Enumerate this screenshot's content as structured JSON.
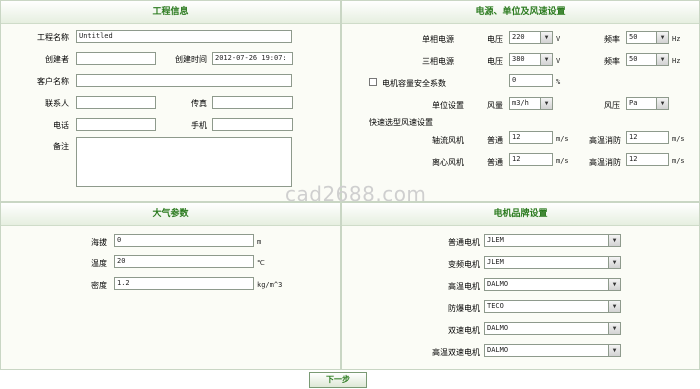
{
  "project": {
    "title": "工程信息",
    "name_label": "工程名称",
    "name_value": "Untitled",
    "creator_label": "创建者",
    "creator_value": "",
    "created_label": "创建时间",
    "created_value": "2012-07-26 19:07:",
    "client_label": "客户名称",
    "client_value": "",
    "contact_label": "联系人",
    "contact_value": "",
    "fax_label": "传真",
    "fax_value": "",
    "phone_label": "电话",
    "phone_value": "",
    "mobile_label": "手机",
    "mobile_value": "",
    "note_label": "备注",
    "note_value": ""
  },
  "power": {
    "title": "电源、单位及风速设置",
    "single_label": "单相电源",
    "voltage_label": "电压",
    "single_voltage": "220",
    "volt_unit": "V",
    "freq_label": "频率",
    "single_freq": "50",
    "hz_unit": "Hz",
    "three_label": "三相电源",
    "three_voltage": "380",
    "three_freq": "50",
    "safety_label": "电机容量安全系数",
    "safety_value": "0",
    "percent_unit": "%",
    "unit_label": "单位设置",
    "flow_label": "风量",
    "flow_value": "m3/h",
    "pressure_label": "风压",
    "pressure_value": "Pa",
    "quick_label": "快速选型风速设置",
    "axial_label": "轴流风机",
    "normal_label": "普通",
    "axial_normal": "12",
    "ms_unit": "m/s",
    "highfire_label": "高温消防",
    "axial_high": "12",
    "centri_label": "离心风机",
    "centri_normal": "12",
    "centri_high": "12"
  },
  "atmo": {
    "title": "大气参数",
    "altitude_label": "海拔",
    "altitude_value": "0",
    "altitude_unit": "m",
    "temp_label": "温度",
    "temp_value": "20",
    "temp_unit": "℃",
    "density_label": "密度",
    "density_value": "1.2",
    "density_unit": "kg/m^3"
  },
  "motor": {
    "title": "电机品牌设置",
    "rows": [
      {
        "label": "普通电机",
        "value": "JLEM"
      },
      {
        "label": "变频电机",
        "value": "JLEM"
      },
      {
        "label": "高温电机",
        "value": "DALMO"
      },
      {
        "label": "防爆电机",
        "value": "TECO"
      },
      {
        "label": "双速电机",
        "value": "DALMO"
      },
      {
        "label": "高温双速电机",
        "value": "DALMO"
      }
    ]
  },
  "footer": {
    "next_label": "下一步"
  },
  "watermark": "cad2688.com"
}
